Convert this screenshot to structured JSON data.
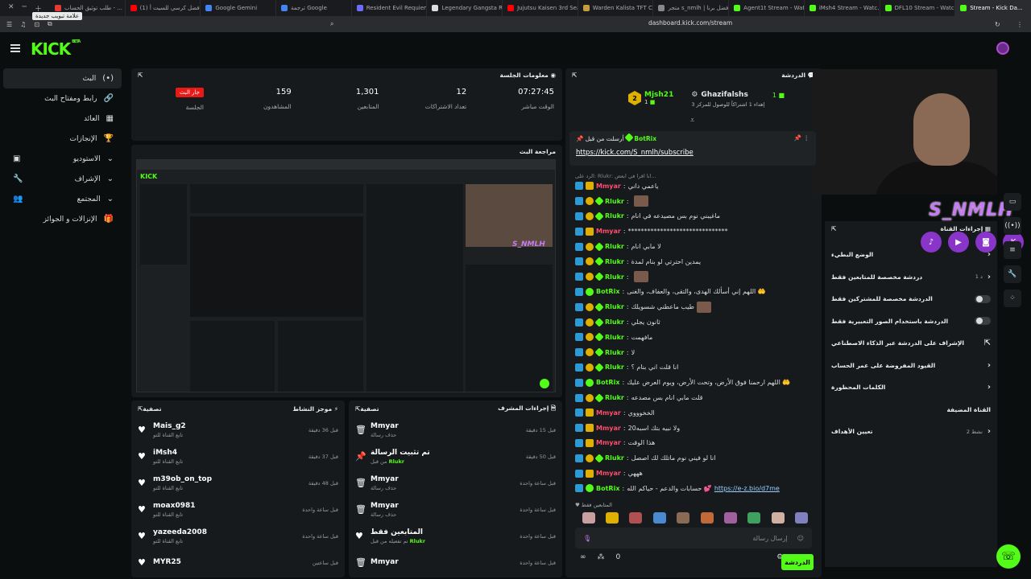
{
  "browser": {
    "tooltip": "علامة تبويب جديدة",
    "tabs": [
      {
        "label": "طلب توثيق الحساب - ...",
        "color": "#e53935"
      },
      {
        "label": "(1) أفضل كرسي للسيت أ...",
        "color": "#ff0000"
      },
      {
        "label": "Google Gemini",
        "color": "#4285f4"
      },
      {
        "label": "ترجمة Google",
        "color": "#4285f4"
      },
      {
        "label": "Resident Evil Requiem",
        "color": "#6c6cff"
      },
      {
        "label": "Legendary Gangsta Rap",
        "color": "#dddddd"
      },
      {
        "label": "Jujutsu Kaisen 3rd Season ...",
        "color": "#ff0000"
      },
      {
        "label": "Warden Kalista TFT Com...",
        "color": "#c59d40"
      },
      {
        "label": "متجر s_nmlh | أفضل برنا...",
        "color": "#888888"
      },
      {
        "label": "Agent1t Stream - Watch ...",
        "color": "#53fc18"
      },
      {
        "label": "iMsh4 Stream - Watc...",
        "color": "#53fc18"
      },
      {
        "label": "DFL10 Stream - Watch ...",
        "color": "#53fc18"
      },
      {
        "label": "Stream - Kick Da...",
        "color": "#53fc18",
        "active": true
      }
    ],
    "url": "dashboard.kick.com/stream"
  },
  "logo": {
    "text": "KICK",
    "beta": "BETA"
  },
  "sidebar": {
    "items": [
      {
        "label": "البث",
        "icon": "(•)",
        "active": true
      },
      {
        "label": "رابط ومفتاح البث",
        "icon": "🔗"
      },
      {
        "label": "العائد",
        "icon": "▦"
      },
      {
        "label": "الإنجازات",
        "icon": "🏆"
      },
      {
        "label": "الاستوديو",
        "icon": "⌄",
        "right": "▣"
      },
      {
        "label": "الإشراف",
        "icon": "⌄",
        "right": "🔧"
      },
      {
        "label": "المجتمع",
        "icon": "⌄",
        "right": "👥"
      },
      {
        "label": "الإنزالات و الجوائز",
        "icon": "🎁"
      }
    ]
  },
  "session": {
    "title": "معلومات الجلسة",
    "stats": [
      {
        "value": "07:27:45",
        "label": "الوقت مباشر"
      },
      {
        "value": "12",
        "label": "تعداد الاشتراكات"
      },
      {
        "value": "1,301",
        "label": "المتابعين"
      },
      {
        "value": "159",
        "label": "المشاهدون"
      },
      {
        "value": "جار البث",
        "label": "الجلسة",
        "badge": true
      }
    ]
  },
  "preview": {
    "title": "مراجعة البث"
  },
  "activity": {
    "title": "موجز النشاط",
    "filter": "تصفية",
    "rows": [
      {
        "name": "Mais_g2",
        "sub": "تابع القناة للتو",
        "time": "قبل 36 دقيقة"
      },
      {
        "name": "iMsh4",
        "sub": "تابع القناة للتو",
        "time": "قبل 37 دقيقة"
      },
      {
        "name": "m39ob_on_top",
        "sub": "تابع القناة للتو",
        "time": "قبل 48 دقيقة"
      },
      {
        "name": "moax0981",
        "sub": "تابع القناة للتو",
        "time": "قبل ساعة واحدة"
      },
      {
        "name": "yazeeda2008",
        "sub": "تابع القناة للتو",
        "time": "قبل ساعة واحدة"
      },
      {
        "name": "MYR25",
        "sub": "",
        "time": "قبل ساعتين"
      }
    ]
  },
  "modactions": {
    "title": "إجراءات المشرف",
    "filter": "تصفية",
    "rows": [
      {
        "icon": "🗑",
        "name": "Mmyar",
        "sub": "حذف رسالة",
        "subHL": "",
        "time": "قبل 15 دقيقة"
      },
      {
        "icon": "📌",
        "name": "تم تثبيت الرسالة",
        "sub": "من قبل",
        "subHL": "Rlukr",
        "time": "قبل 50 دقيقة"
      },
      {
        "icon": "🗑",
        "name": "Mmyar",
        "sub": "حذف رسالة",
        "subHL": "",
        "time": "قبل ساعة واحدة"
      },
      {
        "icon": "🗑",
        "name": "Mmyar",
        "sub": "حذف رسالة",
        "subHL": "",
        "time": "قبل ساعة واحدة"
      },
      {
        "icon": "♥",
        "name": "المتابعين فقط",
        "sub": "تم تفعيله من قبل",
        "subHL": "Rlukr",
        "time": "قبل ساعة واحدة"
      },
      {
        "icon": "🗑",
        "name": "Mmyar",
        "sub": "",
        "subHL": "",
        "time": "قبل ساعة واحدة"
      }
    ]
  },
  "chat": {
    "title": "الدردشة",
    "top": {
      "leftName": "Mjsh21",
      "leftCount": "1",
      "rightName": "Ghazifalshs",
      "rightCount": "1",
      "rightSub": "إهداء 1 اشتراكاً للوصول للمركز 3"
    },
    "pinned": {
      "by": "أرسلت من قبل",
      "name": "BotRix",
      "link": "https://kick.com/S_nmlh/subscribe"
    },
    "replyHint": "الرد على: Rlukr: انا اقرا في ابعض...",
    "lines": [
      {
        "name": "Mmyar",
        "kind": "red",
        "msg": "ياعمي داني"
      },
      {
        "name": "Rlukr",
        "kind": "green",
        "msg": "",
        "emote": true
      },
      {
        "name": "Rlukr",
        "kind": "green",
        "msg": "ماغيبني نوم بس مصيدعه في انام"
      },
      {
        "name": "Mmyar",
        "kind": "red",
        "msg": "*******************************"
      },
      {
        "name": "Rlukr",
        "kind": "green",
        "msg": "لا مابي انام"
      },
      {
        "name": "Rlukr",
        "kind": "green",
        "msg": "يمدين احترتي لو بنام لمدة"
      },
      {
        "name": "Rlukr",
        "kind": "green",
        "msg": "",
        "emote": true
      },
      {
        "name": "BotRix",
        "kind": "bot",
        "msg": "اللهم إني أسألك الهدى، والتقى، والعفاف، والغنى 🤲"
      },
      {
        "name": "Rlukr",
        "kind": "green",
        "msg": "طيب ماعطني شسويلك",
        "emote": true
      },
      {
        "name": "Rlukr",
        "kind": "green",
        "msg": "ثانون يجلي"
      },
      {
        "name": "Rlukr",
        "kind": "green",
        "msg": "مافهمت"
      },
      {
        "name": "Rlukr",
        "kind": "green",
        "msg": "لا"
      },
      {
        "name": "Rlukr",
        "kind": "green",
        "msg": "انا قلت اني بنام ؟"
      },
      {
        "name": "BotRix",
        "kind": "bot",
        "msg": "اللهم ارحمنا فوق الأرض، وتحت الأرض، ويوم العرض عليك 🤲"
      },
      {
        "name": "Rlukr",
        "kind": "green",
        "msg": "قلت مابي انام بس مصدعه"
      },
      {
        "name": "Mmyar",
        "kind": "red",
        "msg": "الخخوووي"
      },
      {
        "name": "Mmyar",
        "kind": "red",
        "msg": "20ولا نبيه بتك اسبه"
      },
      {
        "name": "Mmyar",
        "kind": "red",
        "msg": "هذا الوقت"
      },
      {
        "name": "Rlukr",
        "kind": "green",
        "msg": "انا لو فيني نوم ماتلك لك اصصل"
      },
      {
        "name": "Mmyar",
        "kind": "red",
        "msg": "هههي"
      },
      {
        "name": "BotRix",
        "kind": "bot",
        "msg": "حسابات والدعم - حياكم الله 💕",
        "link": "https://e-z.bio/d7me"
      }
    ],
    "supporters": "المتابعين فقط",
    "placeholder": "إرسال رسالة",
    "count": "0",
    "send": "الدردشة"
  },
  "overlay": {
    "brand": "S_NMLH"
  },
  "channelActions": {
    "title": "إجراءات القناة",
    "rows": [
      {
        "label": "الوضع البطيء",
        "type": "chev"
      },
      {
        "label": "دردشة مخصصة للمتابعين فقط",
        "sub": "1 د",
        "type": "chev"
      },
      {
        "label": "الدردشة مخصصة للمشتركين فقط",
        "type": "toggle"
      },
      {
        "label": "الدردشة باستخدام الصور التعبيرية فقط",
        "type": "toggle"
      },
      {
        "label": "الإشراف على الدردشة عبر الذكاء الاصطناعي",
        "type": "ext"
      },
      {
        "label": "القيود المفروضة على عمر الحساب",
        "type": "chev"
      },
      {
        "label": "الكلمات المحظورة",
        "type": "chev"
      },
      {
        "label": "القناة المضيفة",
        "type": "none"
      },
      {
        "label": "تعيين الأهداف",
        "sub": "نشط 2",
        "type": "chev"
      }
    ]
  }
}
